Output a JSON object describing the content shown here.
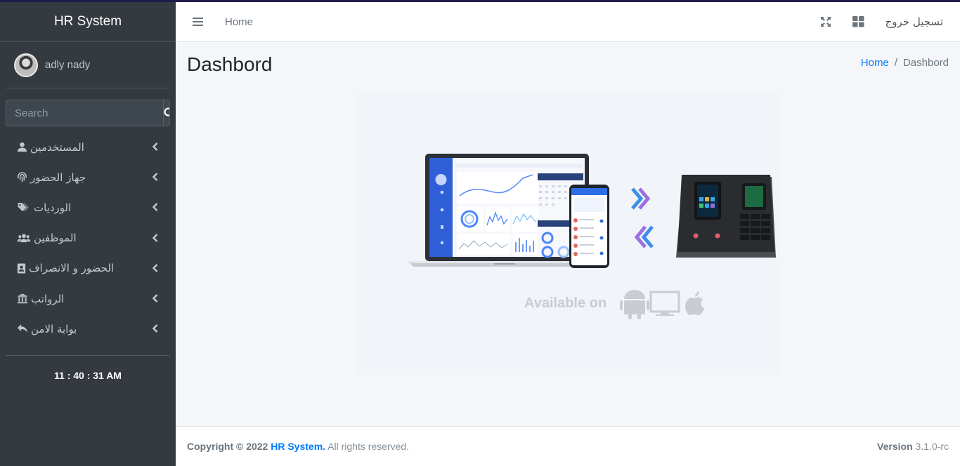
{
  "brand": {
    "title": "HR System"
  },
  "user": {
    "name": "adly nady"
  },
  "search": {
    "placeholder": "Search"
  },
  "sidebar": {
    "items": [
      {
        "label": "المستخدمين",
        "icon": "user-icon"
      },
      {
        "label": "جهاز الحضور",
        "icon": "fingerprint-icon"
      },
      {
        "label": "الورديات",
        "icon": "tags-icon"
      },
      {
        "label": "الموظفين",
        "icon": "users-icon"
      },
      {
        "label": "الحضور و الانصراف",
        "icon": "id-badge-icon"
      },
      {
        "label": "الرواتب",
        "icon": "bank-icon"
      },
      {
        "label": "بوابة الامن",
        "icon": "reply-icon"
      }
    ]
  },
  "clock": "11 : 40 : 31 AM",
  "header": {
    "home_link": "Home",
    "logout_label": "تسجيل خروج"
  },
  "page": {
    "title": "Dashbord"
  },
  "breadcrumb": {
    "home": "Home",
    "separator": "/",
    "current": "Dashbord"
  },
  "hero": {
    "available_text": "Available on"
  },
  "footer": {
    "copyright_prefix": "Copyright © 2022 ",
    "brand": "HR System.",
    "rights": " All rights reserved.",
    "version_label": "Version",
    "version_value": "3.1.0-rc"
  },
  "colors": {
    "sidebar_bg": "#343a40",
    "link_blue": "#007bff",
    "content_bg": "#f4f6f9"
  }
}
